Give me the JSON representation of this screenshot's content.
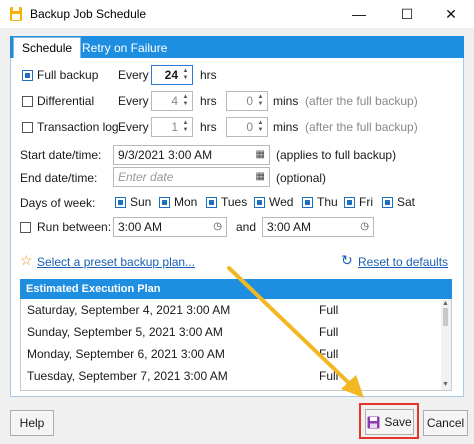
{
  "window": {
    "title": "Backup Job Schedule",
    "minimize": "—",
    "maximize": "☐",
    "close": "✕"
  },
  "tabs": [
    {
      "label": "Schedule"
    },
    {
      "label": "Retry on Failure"
    }
  ],
  "backup": {
    "full": {
      "label": "Full backup",
      "checked": true,
      "every": "Every",
      "value": "24",
      "unit": "hrs"
    },
    "differential": {
      "label": "Differential",
      "checked": false,
      "every": "Every",
      "hrs_value": "4",
      "hrs_unit": "hrs",
      "mins_value": "0",
      "mins_unit": "mins",
      "note": "(after the full backup)"
    },
    "transaction_log": {
      "label": "Transaction log",
      "checked": false,
      "every": "Every",
      "hrs_value": "1",
      "hrs_unit": "hrs",
      "mins_value": "0",
      "mins_unit": "mins",
      "note": "(after the full backup)"
    }
  },
  "start": {
    "label": "Start date/time:",
    "value": "9/3/2021 3:00 AM",
    "note": "(applies to full backup)"
  },
  "end": {
    "label": "End date/time:",
    "placeholder": "Enter date",
    "note": "(optional)"
  },
  "days": {
    "label": "Days of week:",
    "items": [
      {
        "label": "Sun",
        "checked": true
      },
      {
        "label": "Mon",
        "checked": true
      },
      {
        "label": "Tues",
        "checked": true
      },
      {
        "label": "Wed",
        "checked": true
      },
      {
        "label": "Thu",
        "checked": true
      },
      {
        "label": "Fri",
        "checked": true
      },
      {
        "label": "Sat",
        "checked": true
      }
    ]
  },
  "run_between": {
    "label": "Run between:",
    "checked": false,
    "from": "3:00 AM",
    "and": "and",
    "to": "3:00 AM"
  },
  "links": {
    "preset": "Select a preset backup plan...",
    "reset": "Reset to defaults"
  },
  "plan": {
    "header": "Estimated Execution Plan",
    "rows": [
      {
        "date": "Saturday, September 4, 2021 3:00 AM",
        "type": "Full"
      },
      {
        "date": "Sunday, September 5, 2021 3:00 AM",
        "type": "Full"
      },
      {
        "date": "Monday, September 6, 2021 3:00 AM",
        "type": "Full"
      },
      {
        "date": "Tuesday, September 7, 2021 3:00 AM",
        "type": "Full"
      }
    ]
  },
  "buttons": {
    "help": "Help",
    "save": "Save",
    "cancel": "Cancel"
  },
  "colors": {
    "accent": "#1e8fe0",
    "highlight": "#e5342a",
    "arrow": "#f2b824"
  }
}
